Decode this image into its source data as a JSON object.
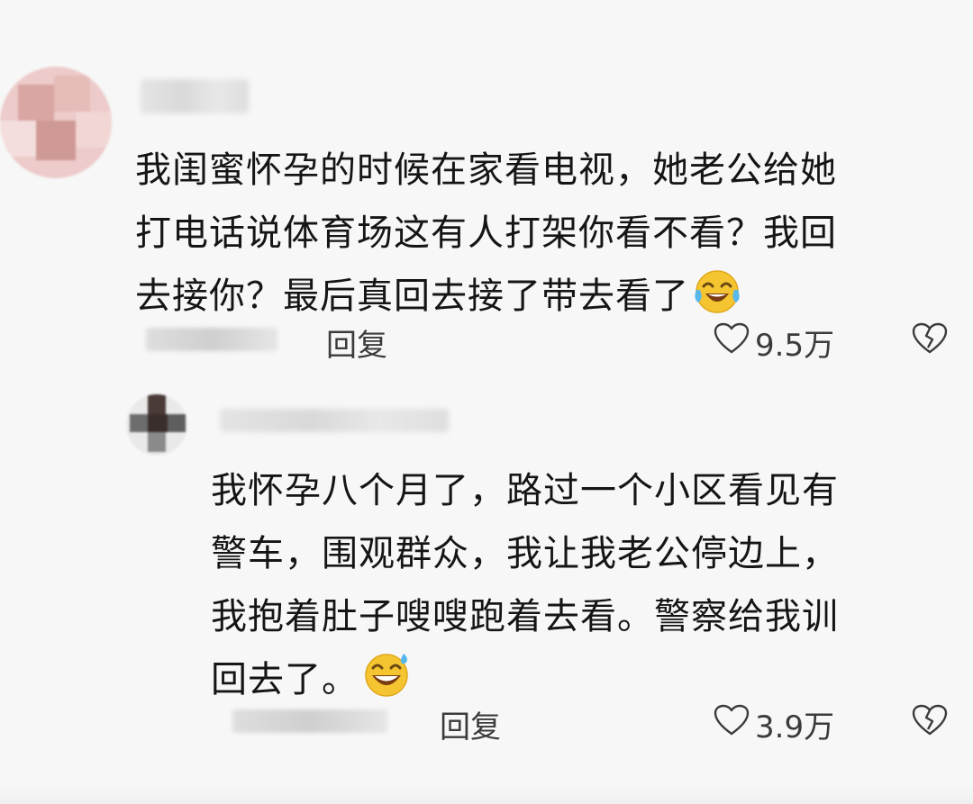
{
  "comments": [
    {
      "lines": [
        "我闺蜜怀孕的时候在家看电视，她老公给她",
        "打电话说体育场这有人打架你看不看？我回",
        "去接你？最后真回去接了带去看了"
      ],
      "emoji": "laugh-cry-emoji",
      "reply_label": "回复",
      "like_count": "9.5万"
    },
    {
      "lines": [
        "我怀孕八个月了，路过一个小区看见有",
        "警车，围观群众，我让我老公停边上，",
        "我抱着肚子嗖嗖跑着去看。警察给我训",
        "回去了。"
      ],
      "emoji": "grin-sweat-emoji",
      "reply_label": "回复",
      "like_count": "3.9万"
    }
  ],
  "colors": {
    "background": "#f7f7f7",
    "text": "#151515",
    "meta": "#3b3b3b",
    "emoji_yellow": "#f5c531",
    "tear_blue": "#58b8ec"
  }
}
